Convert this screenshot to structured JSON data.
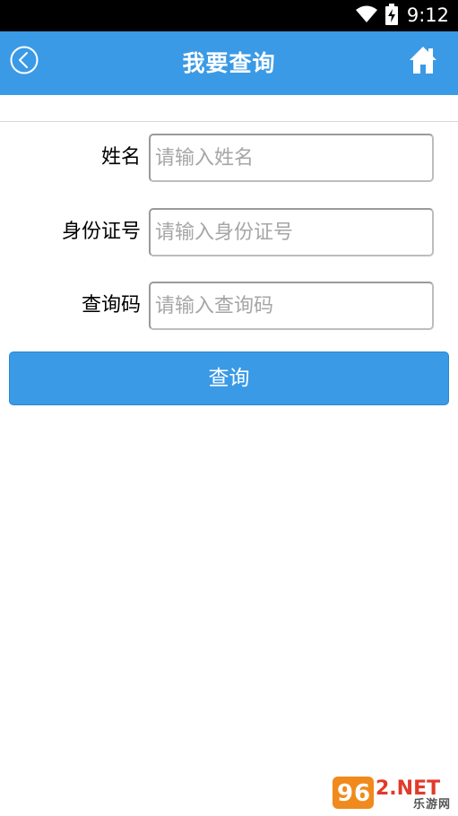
{
  "status_bar": {
    "time": "9:12",
    "icons": [
      "wifi-icon",
      "battery-charging-icon"
    ]
  },
  "header": {
    "title": "我要查询",
    "back_icon": "back-circle-chevron-icon",
    "home_icon": "home-icon",
    "background_color": "#3a9ae6"
  },
  "form": {
    "fields": [
      {
        "label": "姓名",
        "placeholder": "请输入姓名",
        "value": ""
      },
      {
        "label": "身份证号",
        "placeholder": "请输入身份证号",
        "value": ""
      },
      {
        "label": "查询码",
        "placeholder": "请输入查询码",
        "value": ""
      }
    ],
    "submit_label": "查询"
  },
  "watermark": {
    "logo_text": "962.NET",
    "subtitle": "乐游网"
  }
}
